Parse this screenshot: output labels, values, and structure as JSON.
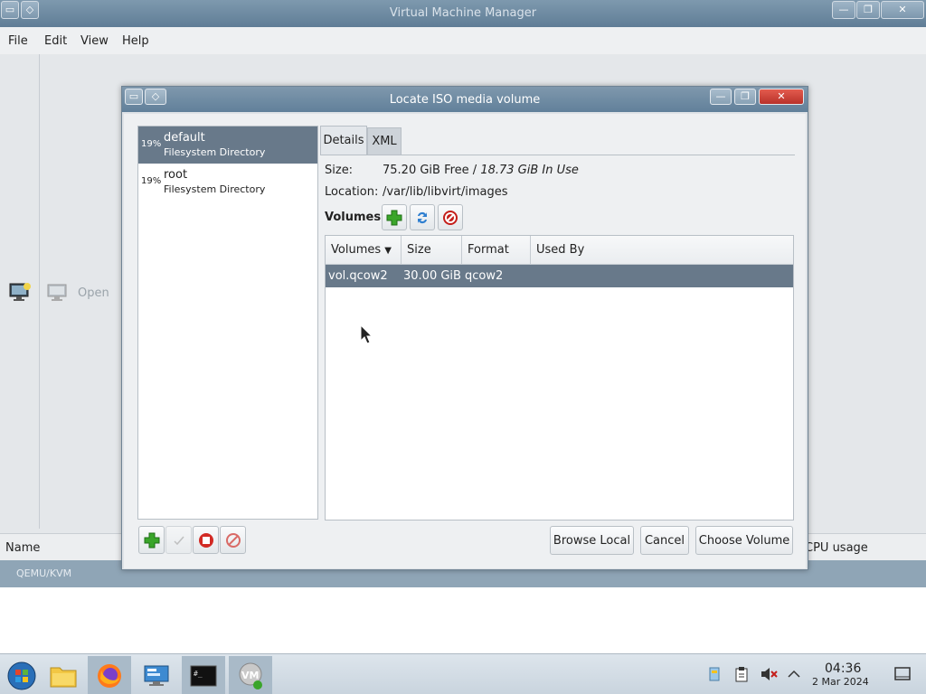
{
  "main_window": {
    "title": "Virtual Machine Manager",
    "menu": [
      "File",
      "Edit",
      "View",
      "Help"
    ],
    "toolbar": {
      "open_label": "Open"
    },
    "list_columns": {
      "name": "Name",
      "cpu": "CPU usage"
    },
    "connection_row": "QEMU/KVM"
  },
  "dialog": {
    "title": "Locate ISO media volume",
    "pools": [
      {
        "percent": "19%",
        "name": "default",
        "type": "Filesystem Directory",
        "selected": true
      },
      {
        "percent": "19%",
        "name": "root",
        "type": "Filesystem Directory",
        "selected": false
      }
    ],
    "tabs": {
      "details": "Details",
      "xml": "XML"
    },
    "details": {
      "size_label": "Size:",
      "size_free": "75.20 GiB Free",
      "size_sep": " / ",
      "size_used": "18.73 GiB In Use",
      "location_label": "Location:",
      "location_value": "/var/lib/libvirt/images",
      "volumes_heading": "Volumes"
    },
    "volume_table": {
      "columns": [
        "Volumes",
        "Size",
        "Format",
        "Used By"
      ],
      "rows": [
        {
          "name": "vol.qcow2",
          "size": "30.00 GiB",
          "format": "qcow2",
          "used_by": ""
        }
      ]
    },
    "buttons": {
      "browse_local": "Browse Local",
      "cancel": "Cancel",
      "choose_volume": "Choose Volume"
    }
  },
  "taskbar": {
    "time": "04:36",
    "date": "2 Mar 2024"
  },
  "colors": {
    "titlebar": "#61809a",
    "selection": "#68798a",
    "close_button": "#c63a30",
    "add_green": "#3aa52a",
    "stop_red": "#d22a24"
  }
}
